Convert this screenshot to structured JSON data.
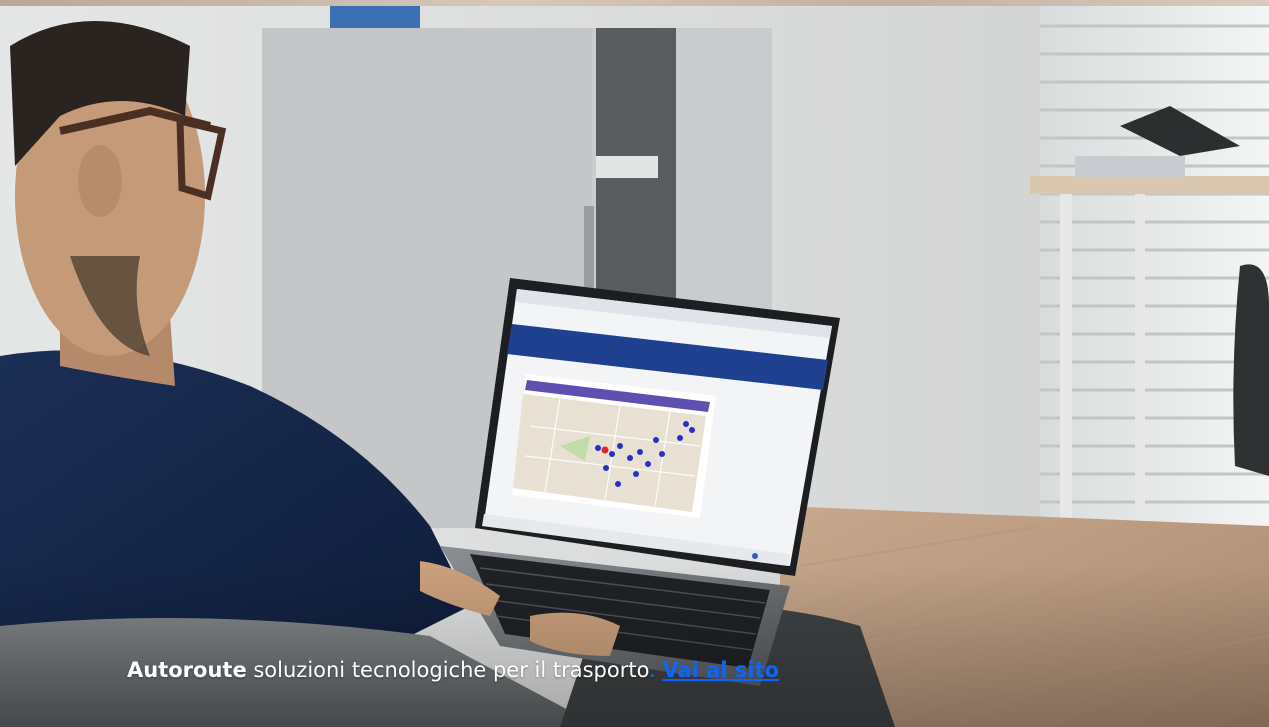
{
  "hero": {
    "image_alt": "Person using a laptop showing a map-based transport planning web app",
    "caption": {
      "brand": "Autoroute",
      "text": " soluzioni tecnologiche per il trasporto",
      "separator": ". ",
      "link_label": "Vai al sito"
    }
  },
  "colors": {
    "link": "#0a66ff",
    "caption_text": "#ffffff",
    "app_header": "#1f3f8f"
  }
}
